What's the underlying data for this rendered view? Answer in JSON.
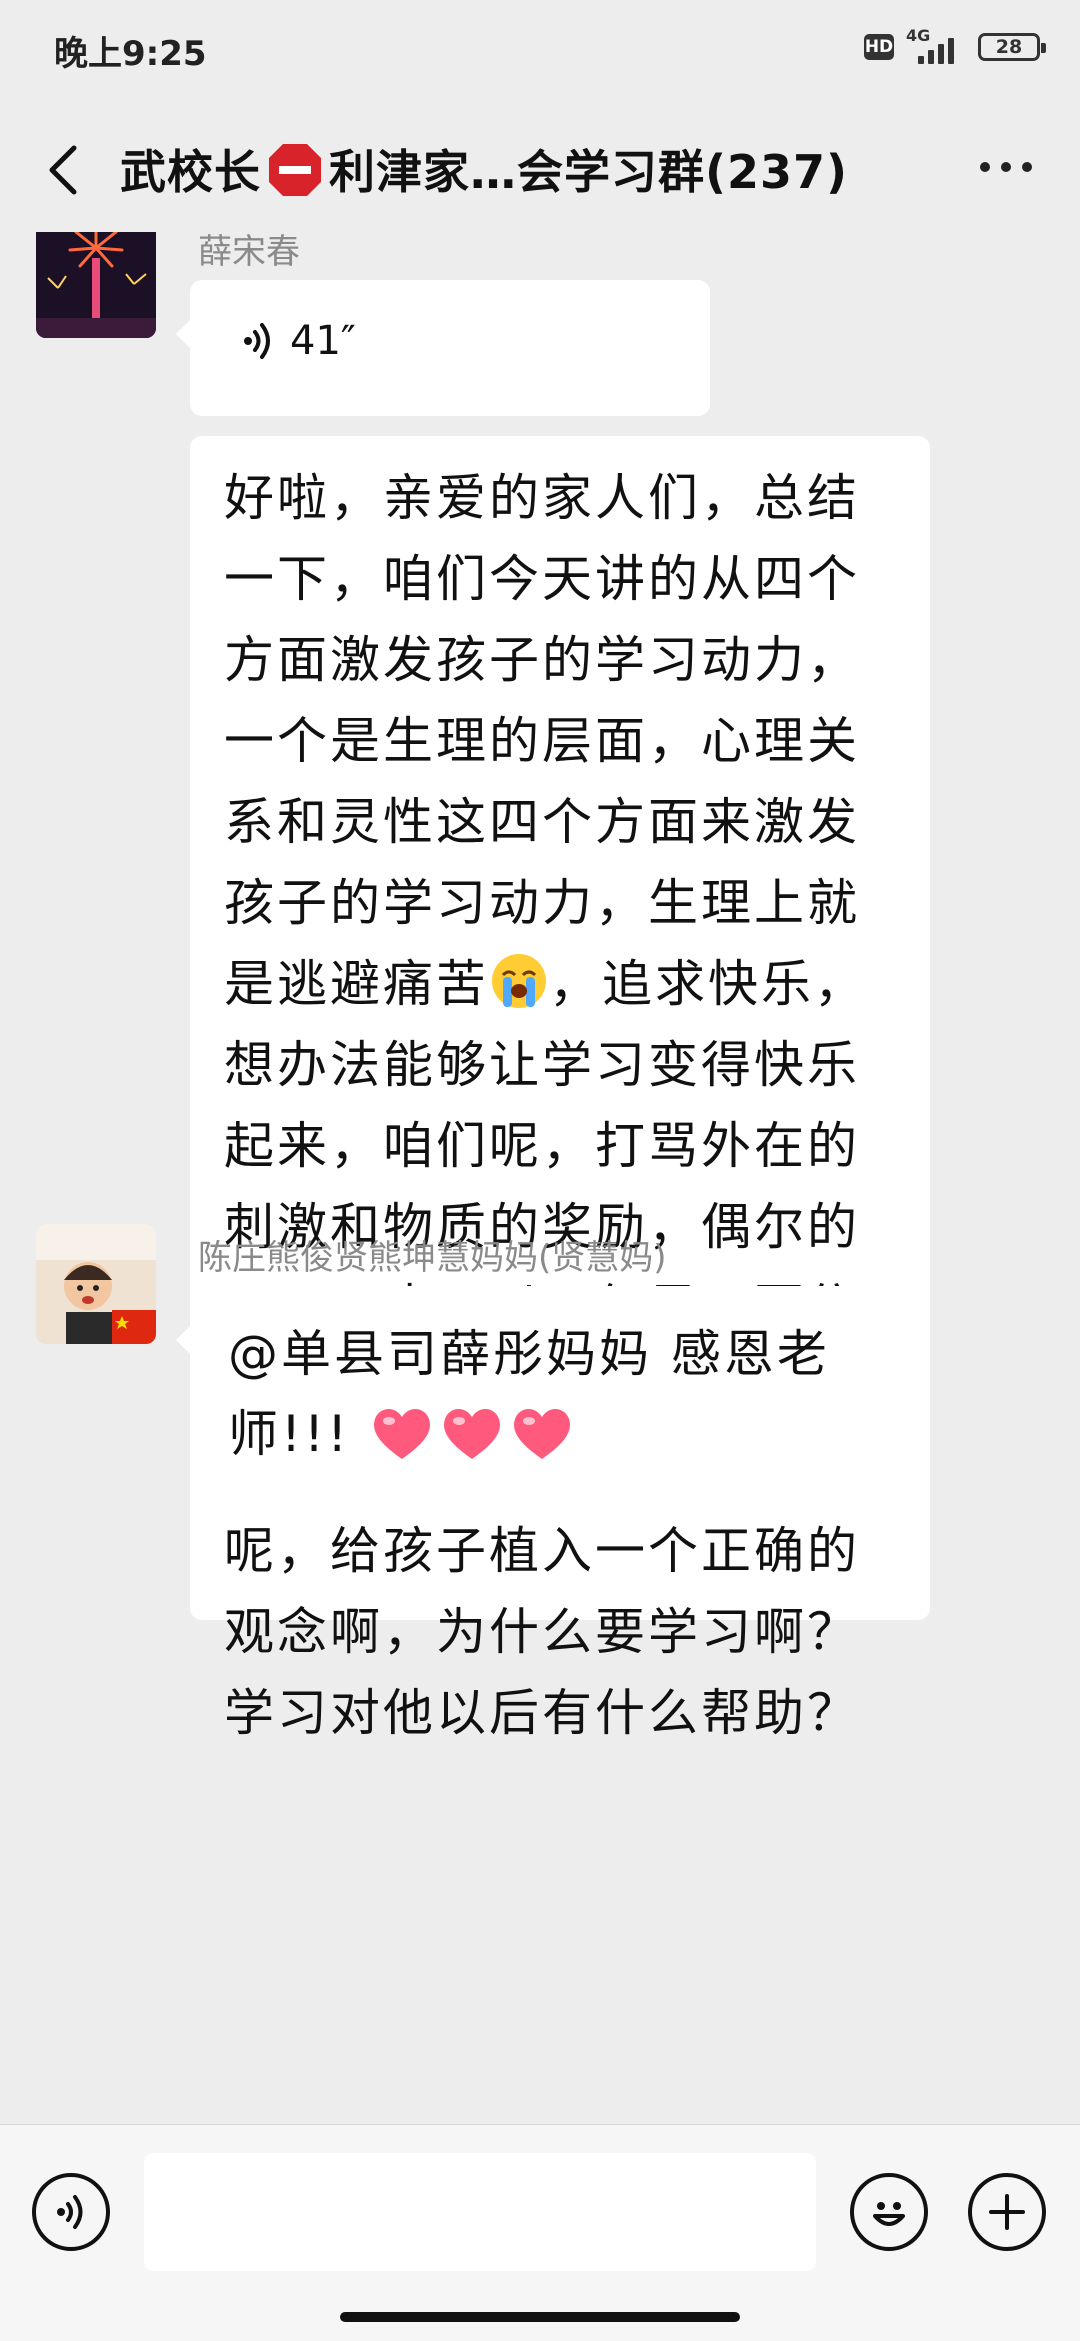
{
  "status_bar": {
    "time": "晚上9:25",
    "hd_label": "HD",
    "network": "4G",
    "battery": "28"
  },
  "header": {
    "title_part1": "武校长",
    "title_part2": "利津家…会学习群(237)",
    "title_icon": "stop-sign-emoji",
    "back_icon": "chevron-left-icon",
    "more_icon": "more-dots-icon"
  },
  "messages": [
    {
      "sender": "薛宋春",
      "type": "voice",
      "duration": "41″",
      "avatar_icon": "fireworks-avatar"
    },
    {
      "type": "text",
      "text_before_emoji": "好啦，亲爱的家人们，总结一下，咱们今天讲的从四个方面激发孩子的学习动力，一个是生理的层面，心理关系和灵性这四个方面来激发孩子的学习动力，生理上就是逃避痛苦",
      "emoji": "crying-face-emoji",
      "text_after_emoji": "，追求快乐，想办法能够让学习变得快乐起来，咱们呢，打骂外在的刺激和物质的奖励，偶尔的用一下也可以，但是不要依赖心理上，就是培养孩子的成就感和荣誉感，在一个是呢，给孩子植入一个正确的观念啊，为什么要学习啊？学习对他以后有什么帮助？"
    },
    {
      "sender": "陈庄熊俊贤熊坤慧妈妈(贤慧妈)",
      "type": "text",
      "text": "@单县司薛彤妈妈  感恩老师!!! ",
      "emoji": "red-heart-emoji x3",
      "avatar_icon": "child-photo-avatar"
    }
  ],
  "input_bar": {
    "voice_icon": "voice-input-icon",
    "placeholder": "",
    "emoji_icon": "smiley-face-icon",
    "plus_icon": "plus-icon"
  },
  "colors": {
    "background": "#ededed",
    "bubble": "#ffffff",
    "sender_name": "#8a8a8a"
  }
}
